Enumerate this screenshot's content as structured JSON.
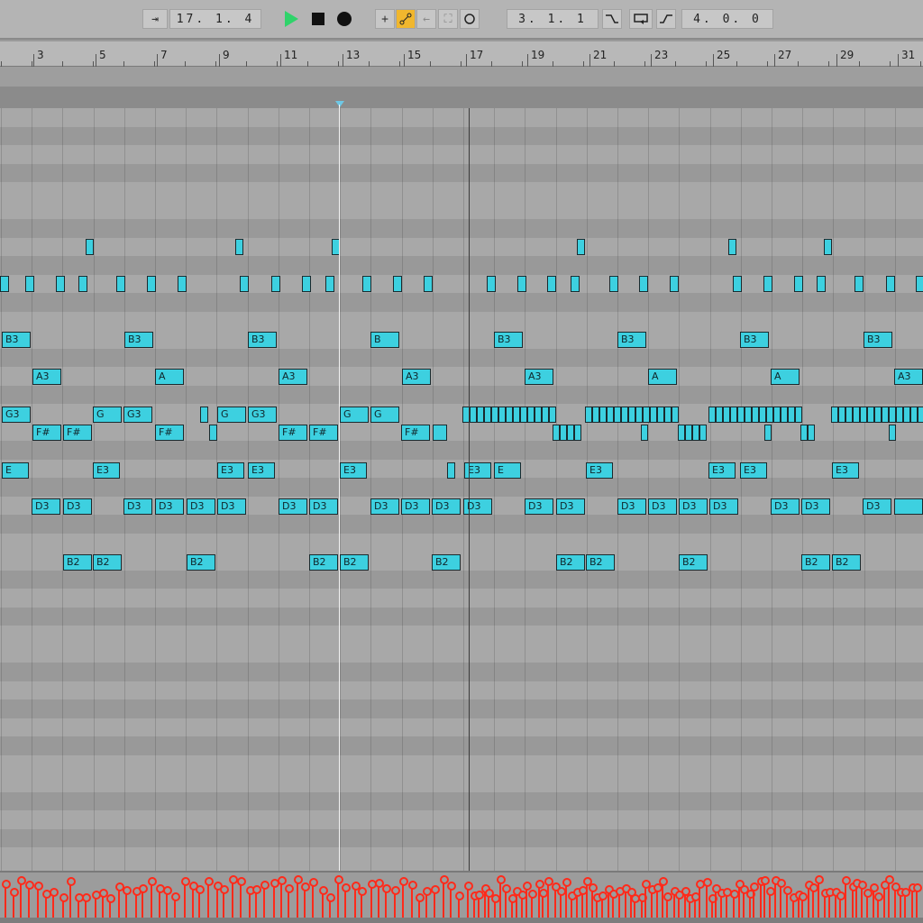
{
  "transport": {
    "arrangement_position": "17. 1. 4",
    "loop_start": "3. 1. 1",
    "loop_length": "4. 0. 0",
    "colors": {
      "play": "#2fd36a",
      "active_toggle": "#f1b72e"
    }
  },
  "ruler": {
    "bar_labels": [
      "3",
      "5",
      "7",
      "9",
      "11",
      "13",
      "15",
      "17",
      "19",
      "21",
      "23",
      "25",
      "27",
      "29",
      "31"
    ]
  },
  "notes": {
    "B3": [
      "B3",
      "B3",
      "B3",
      "B",
      "B3",
      "B3",
      "B3",
      "B3"
    ],
    "A3": [
      "A3",
      "A",
      "A3",
      "A3",
      "A3",
      "A",
      "A",
      "A3"
    ],
    "G3": [
      "G3",
      "G",
      "G3",
      "G",
      "G3",
      "G",
      "G"
    ],
    "F#": [
      "F#",
      "F#",
      "F#",
      "F#",
      "F#",
      "F#"
    ],
    "E3": [
      "E",
      "E3",
      "E3",
      "E3",
      "E3",
      "E3",
      "E",
      "E3",
      "E3",
      "E3",
      "E3"
    ],
    "D3": [
      "D3",
      "D3",
      "D3",
      "D3",
      "D3",
      "D3",
      "D3",
      "D3",
      "D3",
      "D3",
      "D3",
      "D3",
      "D3",
      "D3",
      "D3",
      "D3",
      "D3",
      "D3",
      "D3",
      "D3",
      "D3"
    ],
    "B2": [
      "B2",
      "B2",
      "B2",
      "B2",
      "B2",
      "B2",
      "B2",
      "B2",
      "B2",
      "B2",
      "B2"
    ]
  },
  "colors": {
    "note_fill": "#3dd0e0",
    "velocity": "#ff2a1a"
  }
}
